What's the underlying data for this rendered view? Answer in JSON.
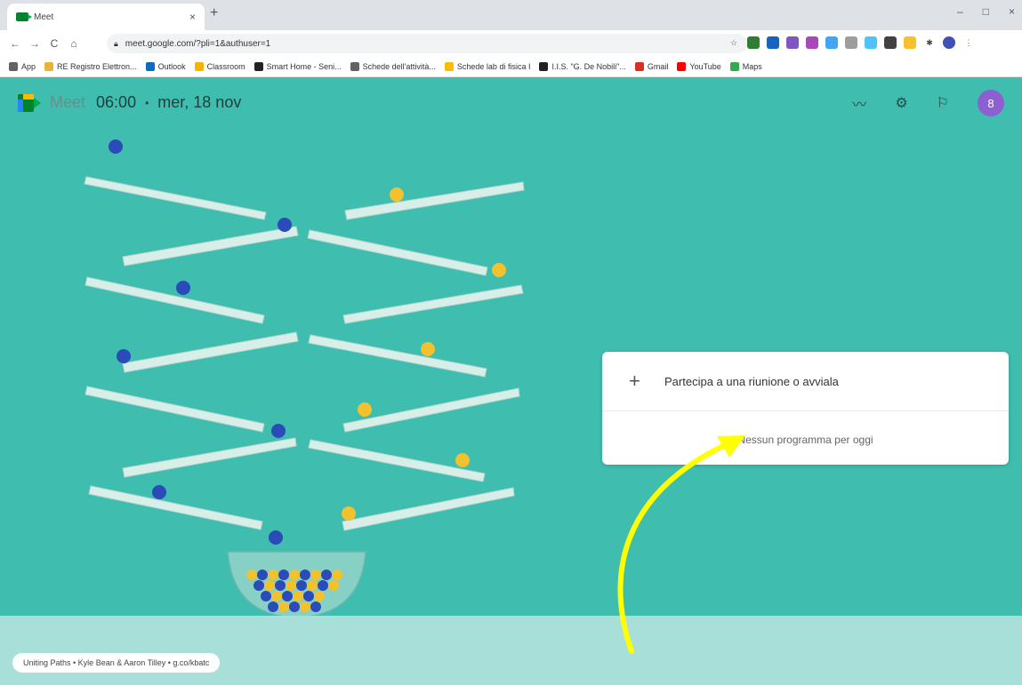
{
  "browser": {
    "tab_title": "Meet",
    "tab_close": "×",
    "new_tab": "+",
    "url": "meet.google.com/?pli=1&authuser=1",
    "window_controls": [
      "–",
      "□",
      "×"
    ],
    "bookmarks": [
      {
        "label": "App",
        "color": "#5f6368"
      },
      {
        "label": "RE Registro Elettron...",
        "color": "#e8b339"
      },
      {
        "label": "Outlook",
        "color": "#0f6cbd"
      },
      {
        "label": "Classroom",
        "color": "#f6b400"
      },
      {
        "label": "Smart Home - Seni...",
        "color": "#222222"
      },
      {
        "label": "Schede dell'attività...",
        "color": "#5f6368"
      },
      {
        "label": "Schede lab di fisica I",
        "color": "#fbbc04"
      },
      {
        "label": "I.I.S. \"G. De Nobili\"...",
        "color": "#222222"
      },
      {
        "label": "Gmail",
        "color": "#d93025"
      },
      {
        "label": "YouTube",
        "color": "#ff0000"
      },
      {
        "label": "Maps",
        "color": "#34a853"
      }
    ]
  },
  "meet": {
    "title": "Meet",
    "time": "06:00",
    "separator": "•",
    "date": "mer, 18 nov",
    "avatar_letter": "8",
    "join_label": "Partecipa a una riunione o avviala",
    "no_schedule": "Nessun programma per oggi",
    "credit": "Uniting Paths • Kyle Bean & Aaron Tilley • g.co/kbatc",
    "colors": {
      "background": "#3fbdae",
      "floor": "#a9dfd9",
      "arrow": "#ffff00",
      "avatar": "#8e5fd1"
    }
  }
}
